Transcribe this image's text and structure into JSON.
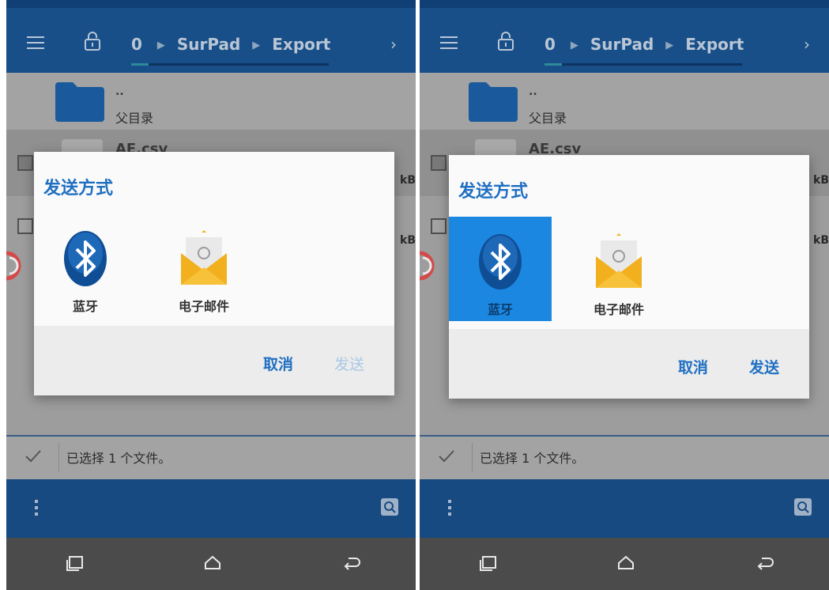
{
  "colors": {
    "primary": "#184f88",
    "accent": "#1f6fc2",
    "selected_target": "#1c87e0",
    "send_disabled": "#a9c8e6"
  },
  "toolbar": {
    "path": [
      "0",
      "SurPad",
      "Export"
    ],
    "menu_icon": "hamburger-menu-icon",
    "lock_icon": "lock-icon",
    "forward_icon": "chevron-right-icon"
  },
  "list": {
    "parent_dots": "..",
    "parent_label": "父目录",
    "file_name": "AE.csv",
    "size_unit": "kB"
  },
  "dialog": {
    "title": "发送方式",
    "targets": [
      {
        "label": "蓝牙",
        "icon": "bluetooth-icon"
      },
      {
        "label": "电子邮件",
        "icon": "email-envelope-icon"
      }
    ],
    "cancel_label": "取消",
    "send_label": "发送"
  },
  "selection_bar": {
    "text": "已选择 1 个文件。"
  },
  "panels": [
    {
      "id": "before",
      "selected_target": null,
      "send_enabled": false
    },
    {
      "id": "after",
      "selected_target": "蓝牙",
      "send_enabled": true
    }
  ]
}
